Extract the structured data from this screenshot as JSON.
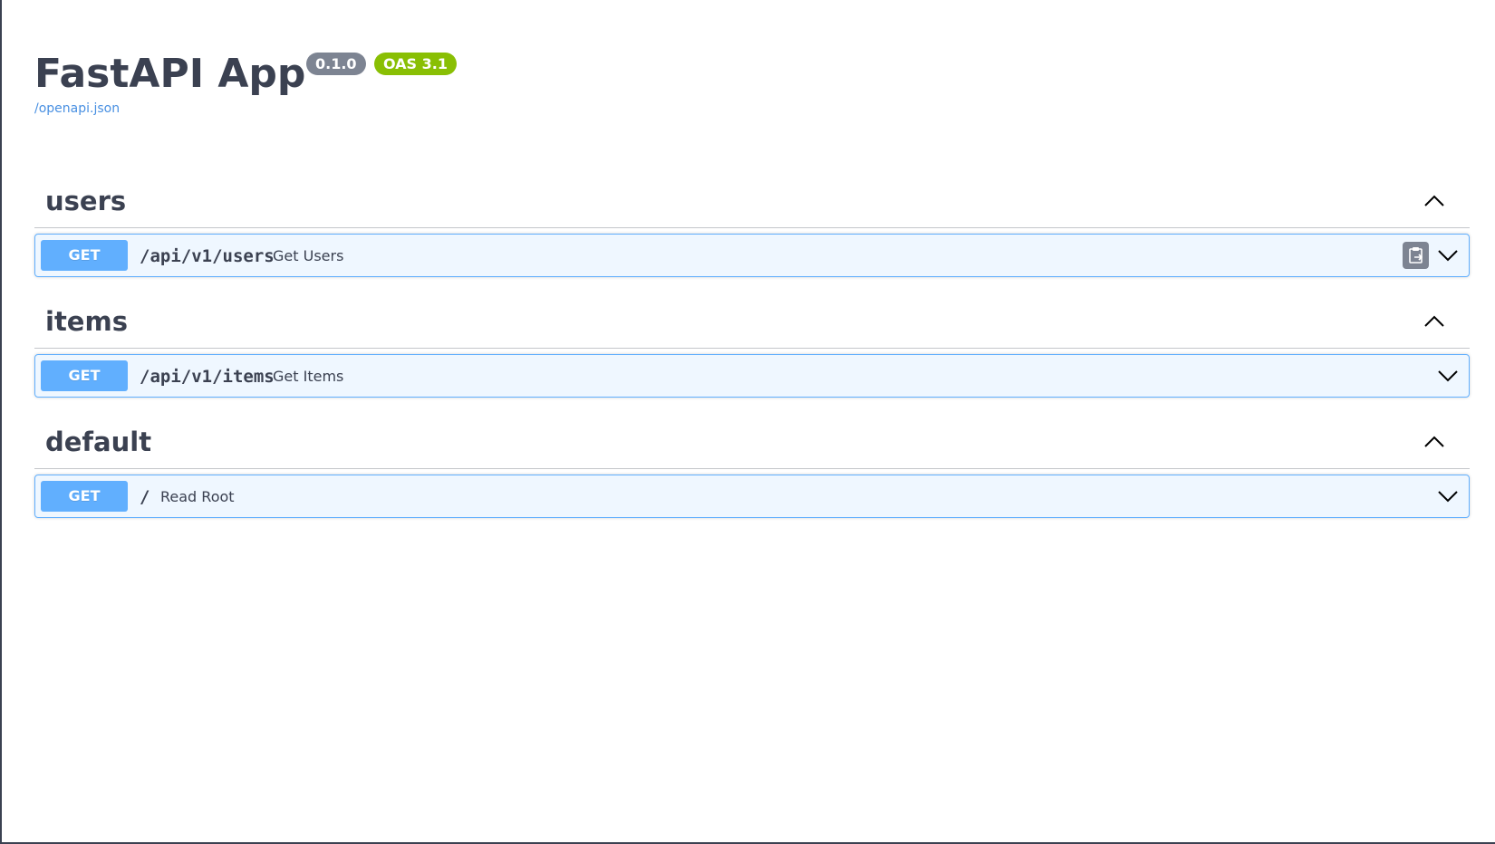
{
  "info": {
    "title": "FastAPI App",
    "version": "0.1.0",
    "oas": "OAS 3.1",
    "spec_link": "/openapi.json"
  },
  "tags": [
    {
      "name": "users",
      "operations": [
        {
          "method": "GET",
          "path": "/api/v1/users",
          "summary": "Get Users",
          "copy_button": true
        }
      ]
    },
    {
      "name": "items",
      "operations": [
        {
          "method": "GET",
          "path": "/api/v1/items",
          "summary": "Get Items",
          "copy_button": false
        }
      ]
    },
    {
      "name": "default",
      "operations": [
        {
          "method": "GET",
          "path": "/",
          "summary": "Read Root",
          "copy_button": false
        }
      ]
    }
  ],
  "colors": {
    "get": "#61affe",
    "version_badge": "#7d8492",
    "oas_badge": "#89bf04",
    "link": "#4990e2",
    "text": "#3b4151"
  },
  "icons": {
    "tag_toggle": "chevron-up-icon",
    "operation_toggle": "chevron-down-icon",
    "copy": "copy-to-clipboard-icon"
  }
}
